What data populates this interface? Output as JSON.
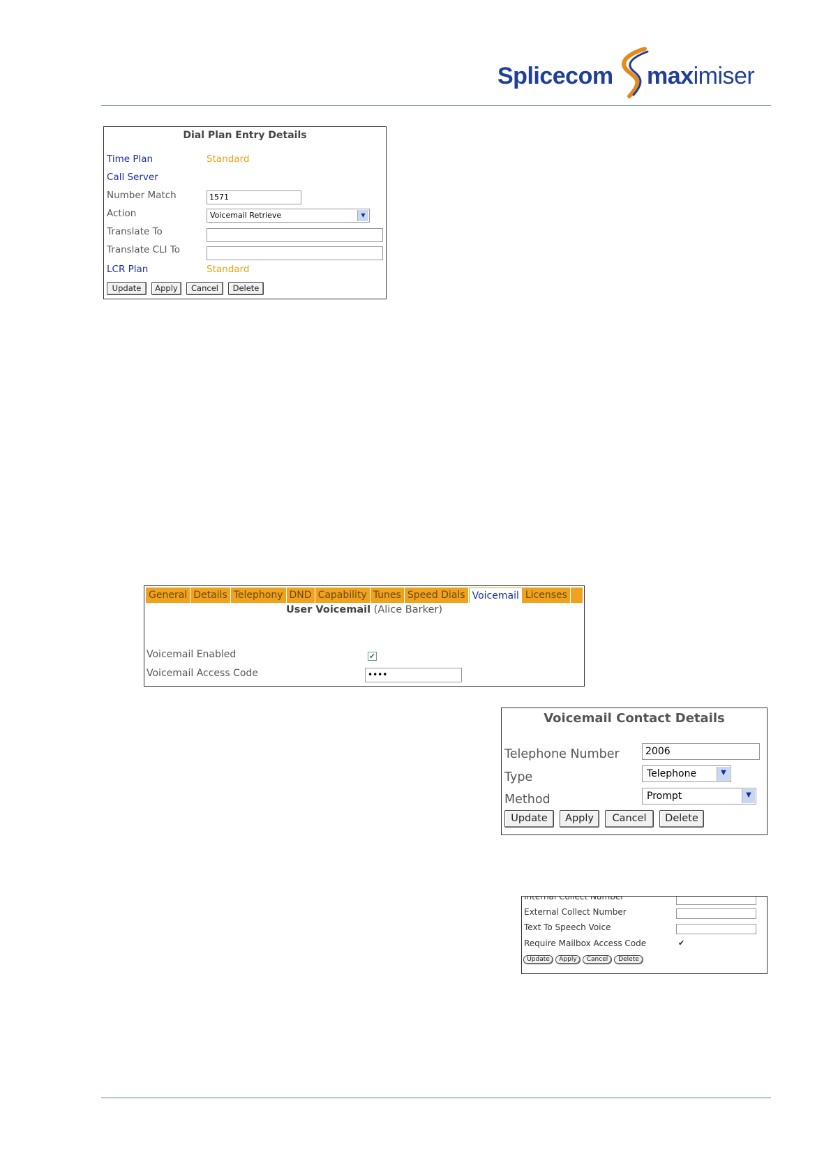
{
  "header": {
    "logo_splice": "Splicecom",
    "logo_max_bold": "max",
    "logo_max_rest": "imiser"
  },
  "dial_plan": {
    "title": "Dial Plan Entry Details",
    "time_plan_label": "Time Plan",
    "time_plan_value": "Standard",
    "call_server_label": "Call Server",
    "number_match_label": "Number Match",
    "number_match_value": "1571",
    "action_label": "Action",
    "action_value": "Voicemail Retrieve",
    "translate_to_label": "Translate To",
    "translate_to_value": "",
    "translate_cli_label": "Translate CLI To",
    "translate_cli_value": "",
    "lcr_plan_label": "LCR Plan",
    "lcr_plan_value": "Standard",
    "buttons": {
      "update": "Update",
      "apply": "Apply",
      "cancel": "Cancel",
      "delete": "Delete"
    }
  },
  "user_voicemail": {
    "tabs": [
      "General",
      "Details",
      "Telephony",
      "DND",
      "Capability",
      "Tunes",
      "Speed Dials",
      "Voicemail",
      "Licenses"
    ],
    "active_tab": "Voicemail",
    "title_bold": "User Voicemail",
    "title_user": "(Alice Barker)",
    "enabled_label": "Voicemail Enabled",
    "enabled_checked": true,
    "access_code_label": "Voicemail Access Code",
    "access_code_value": "••••"
  },
  "contact_details": {
    "title": "Voicemail Contact Details",
    "telephone_label": "Telephone Number",
    "telephone_value": "2006",
    "type_label": "Type",
    "type_value": "Telephone",
    "method_label": "Method",
    "method_value": "Prompt",
    "buttons": {
      "update": "Update",
      "apply": "Apply",
      "cancel": "Cancel",
      "delete": "Delete"
    }
  },
  "collect": {
    "internal_label": "Internal Collect Number",
    "external_label": "External Collect Number",
    "tts_label": "Text To Speech Voice",
    "require_label": "Require Mailbox Access Code",
    "require_checked": true,
    "buttons": {
      "update": "Update",
      "apply": "Apply",
      "cancel": "Cancel",
      "delete": "Delete"
    }
  },
  "colors": {
    "brand_blue": "#1f3f9a",
    "link_blue": "#1a2fa0",
    "value_orange": "#e8a316",
    "tab_orange": "#f0a21e",
    "rule_blue": "#5b7fa8"
  }
}
